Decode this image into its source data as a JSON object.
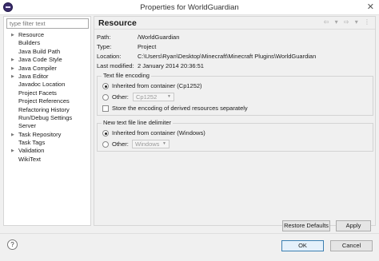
{
  "window": {
    "title": "Properties for WorldGuardian",
    "close_glyph": "✕"
  },
  "sidebar": {
    "filter_placeholder": "type filter text",
    "items": [
      {
        "label": "Resource",
        "expandable": true
      },
      {
        "label": "Builders",
        "expandable": false
      },
      {
        "label": "Java Build Path",
        "expandable": false
      },
      {
        "label": "Java Code Style",
        "expandable": true
      },
      {
        "label": "Java Compiler",
        "expandable": true
      },
      {
        "label": "Java Editor",
        "expandable": true
      },
      {
        "label": "Javadoc Location",
        "expandable": false
      },
      {
        "label": "Project Facets",
        "expandable": false
      },
      {
        "label": "Project References",
        "expandable": false
      },
      {
        "label": "Refactoring History",
        "expandable": false
      },
      {
        "label": "Run/Debug Settings",
        "expandable": false
      },
      {
        "label": "Server",
        "expandable": false
      },
      {
        "label": "Task Repository",
        "expandable": true
      },
      {
        "label": "Task Tags",
        "expandable": false
      },
      {
        "label": "Validation",
        "expandable": true
      },
      {
        "label": "WikiText",
        "expandable": false
      }
    ]
  },
  "page": {
    "title": "Resource",
    "nav": {
      "back": "⇦",
      "back_menu": "▾",
      "forward": "⇨",
      "forward_menu": "▾",
      "more": "⋮"
    },
    "info": {
      "path_label": "Path:",
      "path_value": "/WorldGuardian",
      "type_label": "Type:",
      "type_value": "Project",
      "location_label": "Location:",
      "location_value": "C:\\Users\\Ryan\\Desktop\\Minecraft\\Minecraft Plugins\\WorldGuardian",
      "modified_label": "Last modified:",
      "modified_value": "2 January 2014 20:36:51"
    },
    "encoding": {
      "group_title": "Text file encoding",
      "inherited_label": "Inherited from container (Cp1252)",
      "other_label": "Other:",
      "other_value": "Cp1252",
      "store_label": "Store the encoding of derived resources separately"
    },
    "delimiter": {
      "group_title": "New text file line delimiter",
      "inherited_label": "Inherited from container (Windows)",
      "other_label": "Other:",
      "other_value": "Windows"
    },
    "buttons": {
      "restore_defaults": "Restore Defaults",
      "apply": "Apply"
    }
  },
  "footer": {
    "help": "?",
    "ok": "OK",
    "cancel": "Cancel"
  },
  "colors": {
    "accent_border": "#3c7fb1",
    "window_bg": "#f0f0f0"
  },
  "icons": {
    "app": "eclipse-icon",
    "expand": "triangle-right-icon",
    "help": "help-icon"
  }
}
